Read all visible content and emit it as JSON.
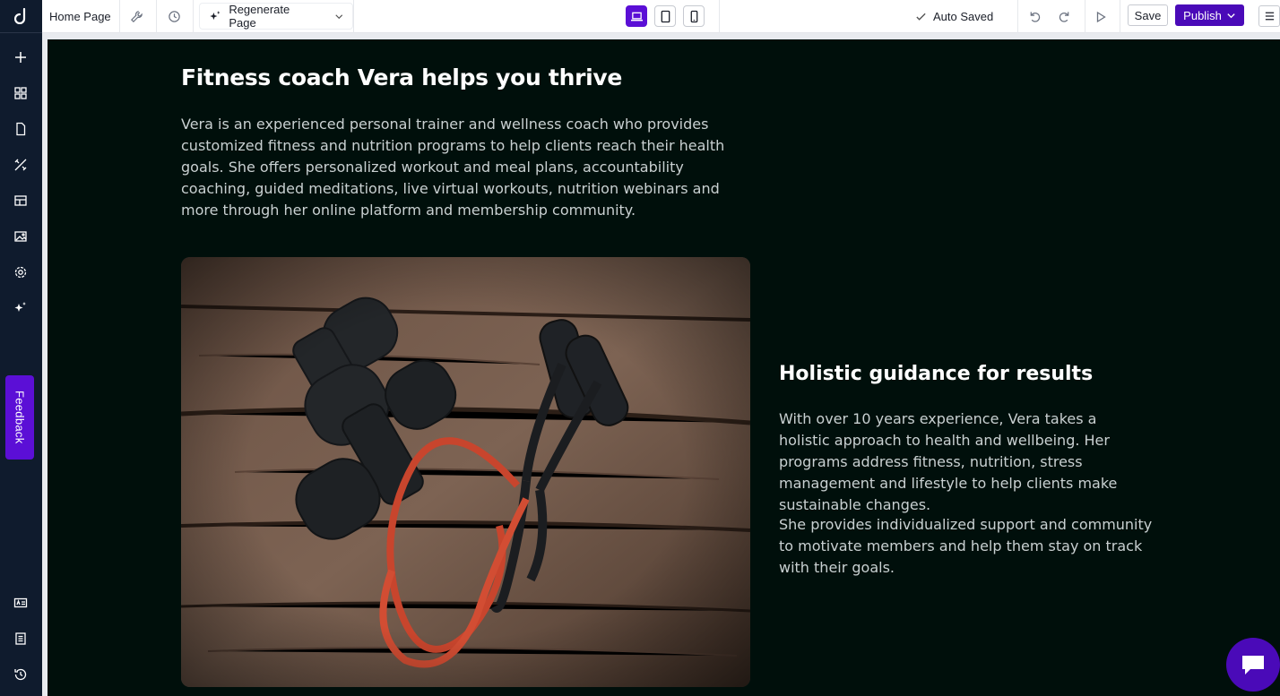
{
  "topbar": {
    "page_name": "Home Page",
    "regenerate_label": "Regenerate Page",
    "status": "Auto Saved",
    "save_label": "Save",
    "publish_label": "Publish"
  },
  "sidebar": {
    "feedback_label": "Feedback",
    "icons": [
      "add-icon",
      "blocks-icon",
      "page-icon",
      "design-tools-icon",
      "layout-icon",
      "media-icon",
      "settings-icon",
      "ai-sparkle-icon",
      "id-card-icon",
      "notes-icon",
      "history-icon"
    ]
  },
  "content": {
    "heading": "Fitness coach Vera helps you thrive",
    "intro": "Vera is an experienced personal trainer and wellness coach who provides customized fitness and nutrition programs to help clients reach their health goals. She offers personalized workout and meal plans, accountability coaching, guided meditations, live virtual workouts, nutrition webinars and more through her online platform and membership community.",
    "subheading": "Holistic guidance for results",
    "paragraph_1": "With over 10 years experience, Vera takes a holistic approach to health and wellbeing. Her programs address fitness, nutrition, stress management and lifestyle to help clients make sustainable changes.",
    "paragraph_2": "She provides individualized support and community to motivate members and help them stay on track with their goals."
  },
  "colors": {
    "accent": "#5b0fd6",
    "publish": "#4a0ab8",
    "sidebar_bg": "#0f1b2d",
    "canvas_bg": "#000f0b"
  }
}
